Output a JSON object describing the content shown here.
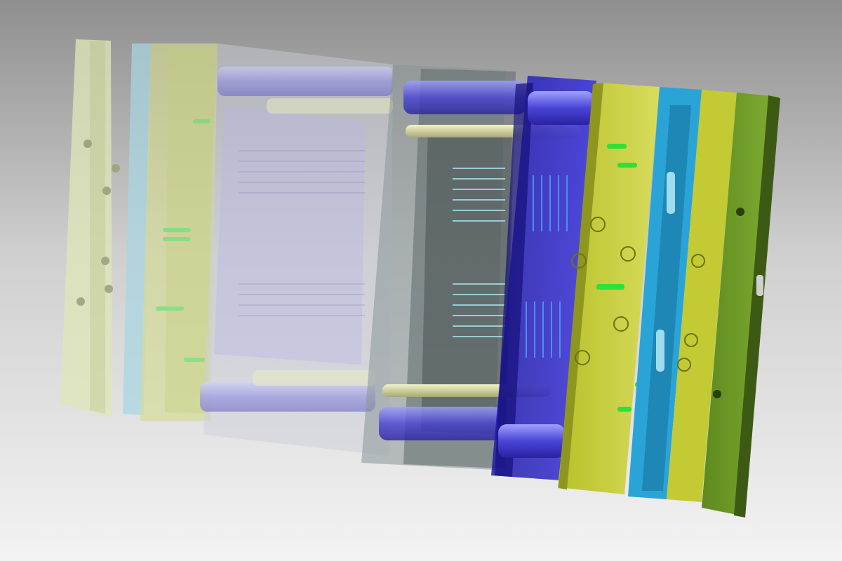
{
  "viewport": {
    "background_top": "#8f8f8f",
    "background_mid": "#cfcfcf",
    "background_bottom": "#f2f2f2"
  },
  "colors": {
    "green_clamp": "#6f9a2a",
    "green_dark": "#3d5a14",
    "yellow_plate": "#c9d034",
    "yellow_light": "#dfe27a",
    "cyan_plate": "#2ea6d8",
    "blue_plate": "#2a22c8",
    "blue_deep": "#1a128f",
    "grey_plate": "#7f8a8c",
    "pin_green": "#2fe03a",
    "ghost_yellow": "#dfe6a0",
    "ghost_blue": "#8a87e6",
    "ghost_grey": "#c9cdd0"
  },
  "model": {
    "description_icon": "injection-mold-assembly",
    "view_mode": "shaded-with-transparency"
  }
}
